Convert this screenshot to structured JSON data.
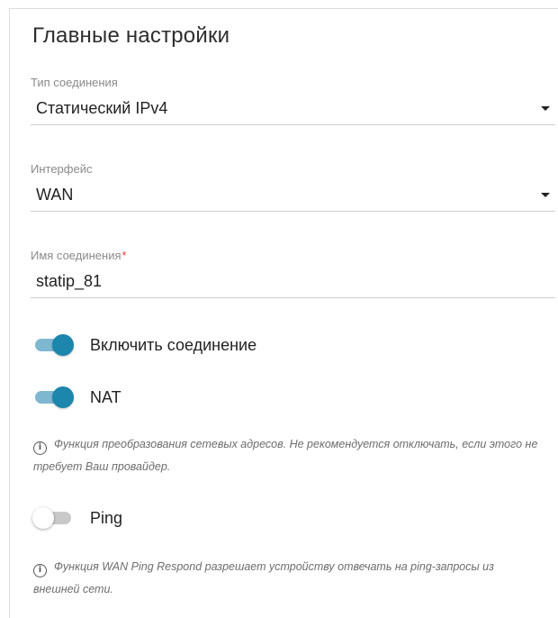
{
  "section": {
    "title": "Главные настройки"
  },
  "fields": {
    "connection_type": {
      "label": "Тип соединения",
      "value": "Статический IPv4"
    },
    "interface": {
      "label": "Интерфейс",
      "value": "WAN"
    },
    "connection_name": {
      "label": "Имя соединения",
      "required_mark": "*",
      "value": "statip_81"
    }
  },
  "toggles": {
    "enable_connection": {
      "label": "Включить соединение",
      "state": "on"
    },
    "nat": {
      "label": "NAT",
      "state": "on"
    },
    "ping": {
      "label": "Ping",
      "state": "off"
    }
  },
  "hints": {
    "nat": "Функция преобразования сетевых адресов. Не рекомендуется отключать, если этого не требует Ваш провайдер.",
    "ping": "Функция WAN Ping Respond разрешает устройству отвечать на ping-запросы из внешней сети."
  },
  "icons": {
    "info": "info-icon",
    "dropdown": "chevron-down-icon"
  },
  "colors": {
    "accent": "#1c86ad",
    "accent_track": "#7fb7d1",
    "off_track": "#c9c9c9",
    "required": "#e53935"
  }
}
